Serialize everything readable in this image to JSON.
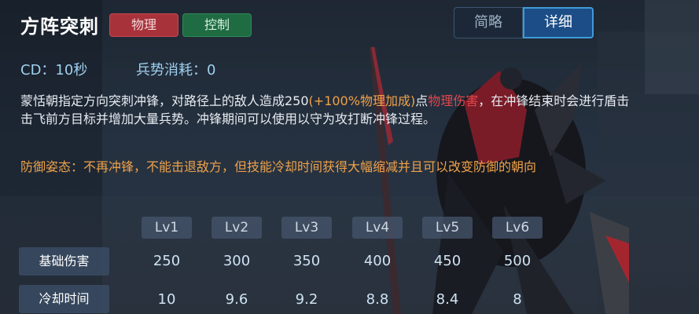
{
  "skill": {
    "name": "方阵突刺",
    "tags": [
      "物理",
      "控制"
    ],
    "cd": "CD：10秒",
    "cost": "兵势消耗：0"
  },
  "view_toggle": {
    "brief": "简略",
    "detail": "详细",
    "selected": "详细"
  },
  "description": {
    "line1_pre": "蒙恬朝指定方向突刺冲锋，对路径上的敌人造成250",
    "line1_scale": "(+100%物理加成)",
    "line1_mid": "点",
    "line1_dmgtype": "物理伤害",
    "line1_post": "，在冲锋结束时会进行盾击击飞前方目标并增加大量兵势。冲锋期间可以使用以守为攻打断冲锋过程。",
    "stance": "防御姿态：不再冲锋，不能击退敌方，但技能冷却时间获得大幅缩减并且可以改变防御的朝向"
  },
  "levels": [
    "Lv1",
    "Lv2",
    "Lv3",
    "Lv4",
    "Lv5",
    "Lv6"
  ],
  "rows": [
    {
      "label": "基础伤害",
      "values": [
        "250",
        "300",
        "350",
        "400",
        "450",
        "500"
      ]
    },
    {
      "label": "冷却时间",
      "values": [
        "10",
        "9.6",
        "9.2",
        "8.8",
        "8.4",
        "8"
      ]
    }
  ],
  "colors": {
    "physical_tag": "#a8323a",
    "control_tag": "#1f6b42",
    "highlight_orange": "#f0a24a",
    "highlight_red": "#e0474d",
    "stat_blue": "#9fd0ee"
  }
}
